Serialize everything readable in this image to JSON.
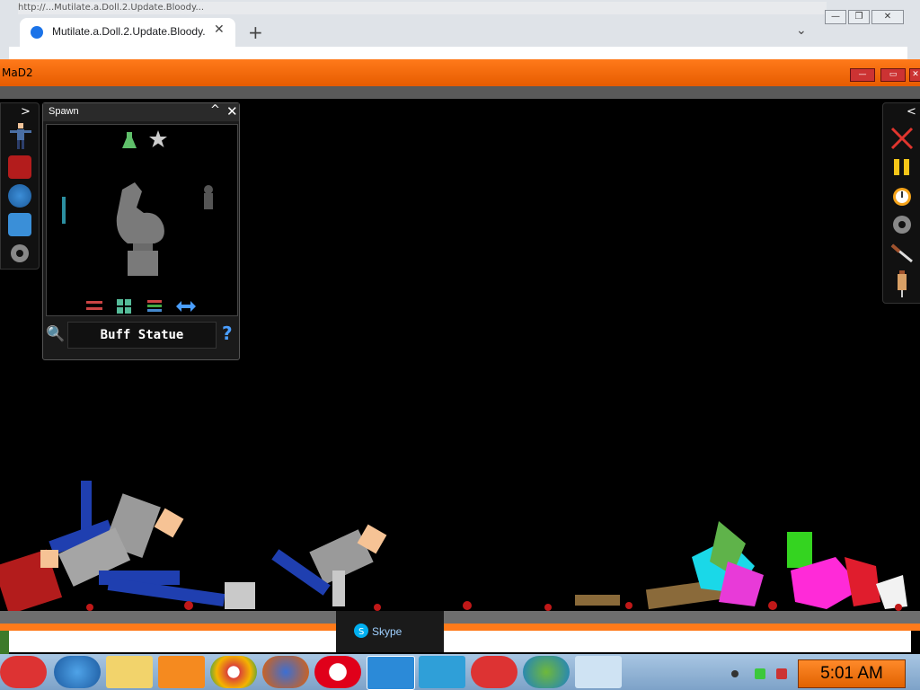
{
  "browser": {
    "url_fragment": "http://...Mutilate.a.Doll.2.Update.Bloody...",
    "tab_title": "Mutilate.a.Doll.2.Update.Bloody.!",
    "tab_close": "✕",
    "new_tab": "+",
    "tab_menu": "⌄",
    "window_buttons": [
      "—",
      "❐",
      "✕"
    ]
  },
  "game": {
    "title": "MaD2",
    "window_buttons": [
      "—",
      "▭",
      "✕"
    ],
    "left_toolbar": {
      "toggle": ">",
      "icons": [
        "ragdoll-icon",
        "book-icon",
        "globe-icon",
        "save-icon",
        "gear-icon"
      ]
    },
    "spawn_panel": {
      "title": "Spawn",
      "collapse": "^",
      "close": "✕",
      "top_icons": [
        "flask-icon",
        "star-icon"
      ],
      "bottom_icons": [
        "shuffle-icon",
        "grid-icon",
        "list-icon",
        "swap-icon"
      ],
      "selected_item": "Buff Statue",
      "help": "?"
    },
    "right_toolbar": {
      "toggle": "<",
      "icons": [
        "clear-icon",
        "pause-icon",
        "stopwatch-icon",
        "gear-icon",
        "knife-icon",
        "syringe-icon"
      ]
    }
  },
  "skype_popup": {
    "label": "Skype"
  },
  "taskbar": {
    "items": [
      "angry-birds-icon",
      "internet-explorer-icon",
      "file-explorer-icon",
      "media-player-icon",
      "chrome-icon",
      "firefox-icon",
      "opera-icon",
      "skype-icon",
      "3d-box-icon",
      "angry-birds-icon",
      "network-icon",
      "figure-icon"
    ],
    "clock": "5:01 AM"
  },
  "colors": {
    "orange": "#ff7a1a",
    "taskbar": "#a8c6e3"
  }
}
